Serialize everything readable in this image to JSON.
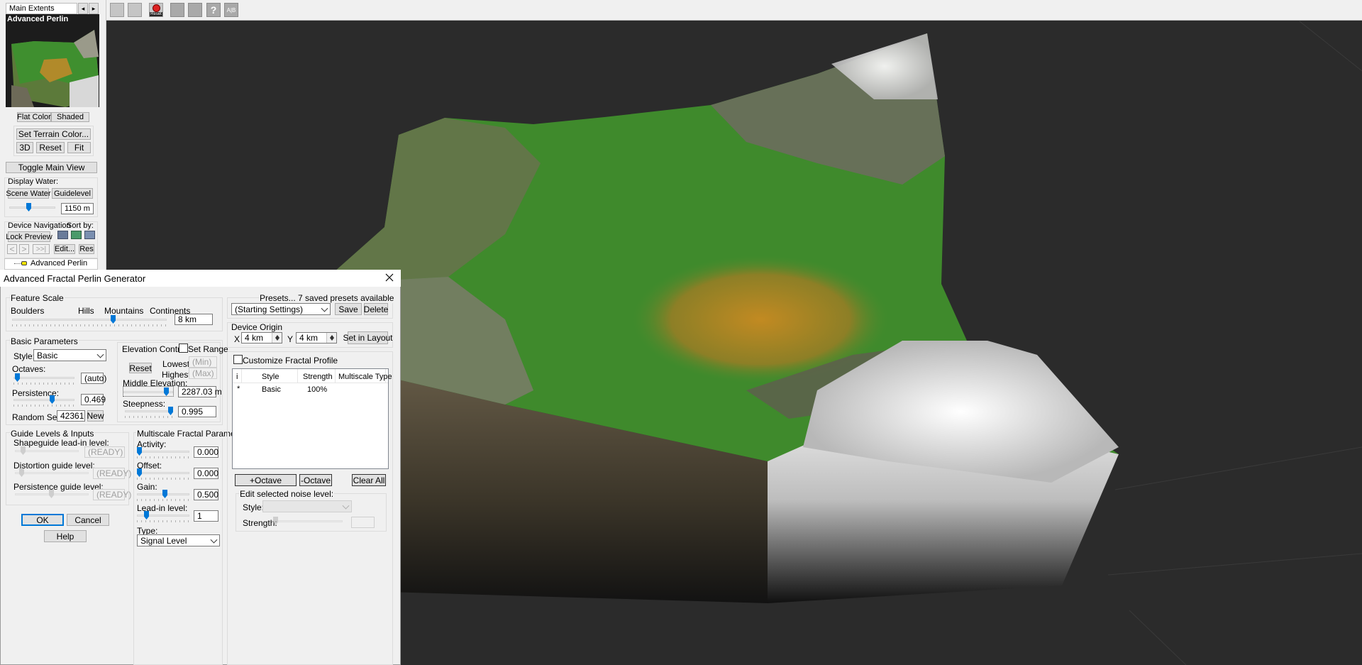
{
  "toolbar": {
    "icons": [
      "grid-icon",
      "layers-icon",
      "reset-icon",
      "view-icon",
      "render-icon",
      "help-icon",
      "text-icon"
    ],
    "reset_label": "Reset",
    "help_glyph": "?",
    "text_glyph": "A|B"
  },
  "left_panel": {
    "extents_value": "Main Extents",
    "preview_title": "Advanced Perlin",
    "flat_color": "Flat Color",
    "shaded": "Shaded",
    "set_terrain_color": "Set Terrain Color...",
    "btn_3d": "3D",
    "btn_reset": "Reset",
    "btn_fit": "Fit",
    "toggle_main_view": "Toggle Main View",
    "display_water": "Display Water:",
    "scene_water": "Scene Water",
    "guidelevel": "Guidelevel",
    "water_level": "1150 m",
    "device_navigation": "Device Navigation",
    "sort_by": "Sort by:",
    "lock_preview": "Lock Preview",
    "nav_prev": "<",
    "nav_next": ">",
    "nav_last": ">>|",
    "edit": "Edit...",
    "res": "Res",
    "device_item": "Advanced Perlin"
  },
  "dialog": {
    "title": "Advanced Fractal Perlin Generator",
    "feature_scale": {
      "group": "Feature Scale",
      "labels": [
        "Boulders",
        "Hills",
        "Mountains",
        "Continents"
      ],
      "value": "8 km",
      "slider_pos": 0.67
    },
    "basic": {
      "group": "Basic Parameters",
      "style_label": "Style:",
      "style_value": "Basic",
      "octaves_label": "Octaves:",
      "octaves_value": "(auto)",
      "octaves_pos": 0.02,
      "persistence_label": "Persistence:",
      "persistence_value": "0.469",
      "persistence_pos": 0.6,
      "seed_label": "Random Seed:",
      "seed_value": "42361",
      "new_label": "New"
    },
    "elevation": {
      "group": "Elevation Control",
      "set_range": "Set Range",
      "reset": "Reset",
      "lowest": "Lowest",
      "lowest_value": "(Min)",
      "highest": "Highest",
      "highest_value": "(Max)",
      "middle_label": "Middle Elevation:",
      "middle_value": "2287.03 m",
      "middle_pos": 0.8,
      "steepness_label": "Steepness:",
      "steepness_value": "0.995",
      "steepness_pos": 0.9
    },
    "guide": {
      "group": "Guide Levels & Inputs",
      "shapeguide": "Shapeguide lead-in level:",
      "shapeguide_value": "(READY)",
      "distortion": "Distortion guide level:",
      "distortion_value": "(READY)",
      "persistence": "Persistence guide level:",
      "persistence_value": "(READY)"
    },
    "multiscale": {
      "group": "Multiscale Fractal Parameters",
      "activity_label": "Activity:",
      "activity_value": "0.000",
      "offset_label": "Offset:",
      "offset_value": "0.000",
      "gain_label": "Gain:",
      "gain_value": "0.500",
      "leadin_label": "Lead-in level:",
      "leadin_value": "1",
      "type_label": "Type:",
      "type_value": "Signal Level"
    },
    "presets": {
      "label": "Presets... 7 saved presets available",
      "value": "(Starting Settings)",
      "save": "Save",
      "delete": "Delete"
    },
    "origin": {
      "group": "Device Origin",
      "x_label": "X",
      "x_value": "4 km",
      "y_label": "Y",
      "y_value": "4 km",
      "set_in_layout": "Set in Layout"
    },
    "profile": {
      "customize": "Customize Fractal Profile",
      "columns": [
        "i",
        "Style",
        "Strength",
        "Multiscale Type"
      ],
      "rows": [
        {
          "i": "*",
          "style": "Basic",
          "strength": "100%",
          "type": ""
        }
      ],
      "add_octave": "+Octave",
      "remove_octave": "-Octave",
      "clear_all": "Clear All",
      "edit_group": "Edit selected noise level:",
      "style_label": "Style:",
      "strength_label": "Strength:"
    },
    "ok": "OK",
    "cancel": "Cancel",
    "help": "Help"
  }
}
